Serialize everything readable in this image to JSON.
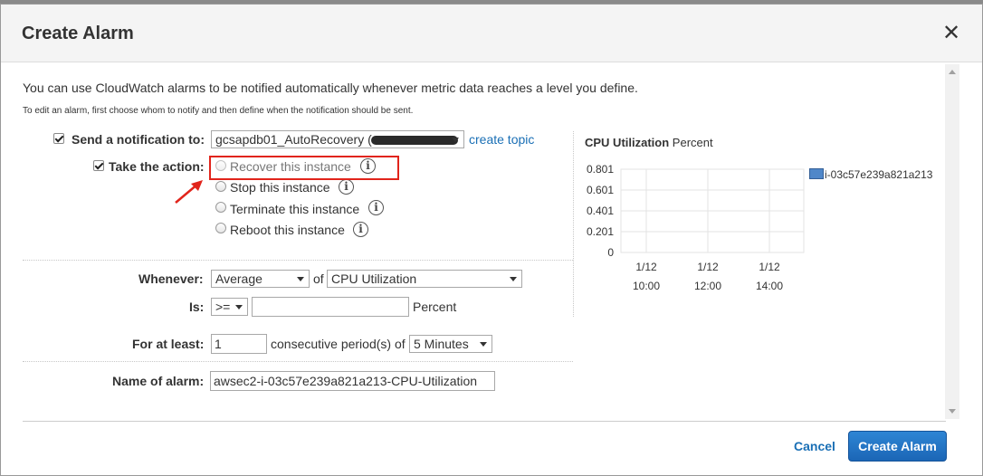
{
  "dialog": {
    "title": "Create Alarm",
    "close_glyph": "✕",
    "intro": "You can use CloudWatch alarms to be notified automatically whenever metric data reaches a level you define.",
    "subnote": "To edit an alarm, first choose whom to notify and then define when the notification should be sent."
  },
  "notify": {
    "checked": true,
    "label": "Send a notification to:",
    "topic_value": "gcsapdb01_AutoRecovery (",
    "create_topic_link": "create topic"
  },
  "action": {
    "checked": true,
    "label": "Take the action:",
    "options": [
      {
        "label": "Recover this instance",
        "disabled": true
      },
      {
        "label": "Stop this instance",
        "disabled": false
      },
      {
        "label": "Terminate this instance",
        "disabled": false
      },
      {
        "label": "Reboot this instance",
        "disabled": false
      }
    ],
    "info_glyph": "i"
  },
  "condition": {
    "whenever_label": "Whenever:",
    "statistic": "Average",
    "of_label": "of",
    "metric": "CPU Utilization",
    "is_label": "Is:",
    "operator": ">=",
    "threshold": "",
    "unit": "Percent",
    "for_at_least_label": "For at least:",
    "periods": "1",
    "periods_suffix": "consecutive period(s) of",
    "period_length": "5 Minutes"
  },
  "name": {
    "label": "Name of alarm:",
    "value": "awsec2-i-03c57e239a821a213-CPU-Utilization"
  },
  "chart_data": {
    "type": "line",
    "title": "CPU Utilization",
    "unit": "Percent",
    "y_ticks": [
      "0.801",
      "0.601",
      "0.401",
      "0.201",
      "0"
    ],
    "x_ticks": [
      {
        "date": "1/12",
        "time": "10:00"
      },
      {
        "date": "1/12",
        "time": "12:00"
      },
      {
        "date": "1/12",
        "time": "14:00"
      }
    ],
    "series": [
      {
        "name": "i-03c57e239a821a213",
        "values": [],
        "color": "#4f87c9"
      }
    ],
    "ylim": [
      0,
      0.801
    ],
    "grid": true,
    "legend": "right"
  },
  "footer": {
    "cancel": "Cancel",
    "create": "Create Alarm"
  },
  "colors": {
    "accent": "#1a6fb5",
    "primary_button": "#1b66b6",
    "highlight": "#e1241b"
  }
}
